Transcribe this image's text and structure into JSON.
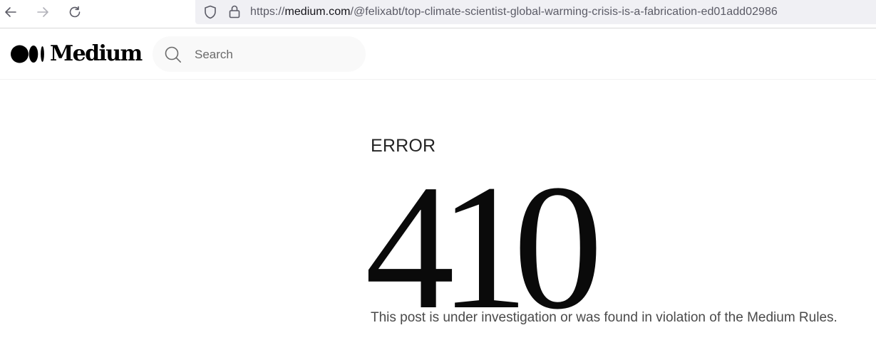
{
  "browser": {
    "back_icon": "arrow-left-icon",
    "forward_icon": "arrow-right-icon",
    "reload_icon": "reload-icon",
    "url_scheme": "https://",
    "url_host": "medium.com",
    "url_path": "/@felixabt/top-climate-scientist-global-warming-crisis-is-a-fabrication-ed01add02986"
  },
  "header": {
    "logo_text": "Medium",
    "search_placeholder": "Search"
  },
  "error": {
    "label": "ERROR",
    "code": "410",
    "message": "This post is under investigation or was found in violation of the Medium Rules."
  },
  "colors": {
    "text_primary": "#242424",
    "text_secondary": "#6b6b6b",
    "search_bg": "#f9f9f9",
    "url_bar_bg": "#f0f0f4"
  }
}
